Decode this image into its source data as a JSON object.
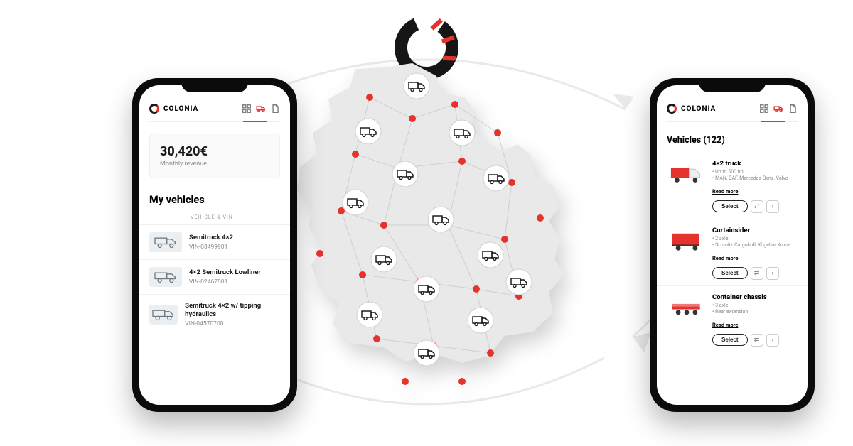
{
  "brand": "COLONIA",
  "left_phone": {
    "nav": {
      "tab_active": "VEHICLES"
    },
    "revenue": {
      "amount": "30,420€",
      "label": "Monthly revenue"
    },
    "section_title": "My vehicles",
    "column_header": "VEHICLE & VIN",
    "vehicles": [
      {
        "name": "Semitruck 4×2",
        "vin": "VIN-03499901"
      },
      {
        "name": "4×2 Semitruck Lowliner",
        "vin": "VIN-02467801"
      },
      {
        "name": "Semitruck 4×2 w/ tipping hydraulics",
        "vin": "VIN-04570700"
      }
    ]
  },
  "right_phone": {
    "nav": {
      "tab_active": "VEHICLES"
    },
    "title": "Vehicles (122)",
    "read_more": "Read more",
    "select_label": "Select",
    "items": [
      {
        "name": "4×2 truck",
        "bullet1": "• Up to 500 hp",
        "bullet2": "• MAN, DAF, Mercedes-Benz, Volvo"
      },
      {
        "name": "Curtainsider",
        "bullet1": "• 2 axle",
        "bullet2": "• Schmitz Cargobull, Kögel or Krone"
      },
      {
        "name": "Container chassis",
        "bullet1": "• 3 axle",
        "bullet2": "• Rear extension"
      }
    ]
  }
}
